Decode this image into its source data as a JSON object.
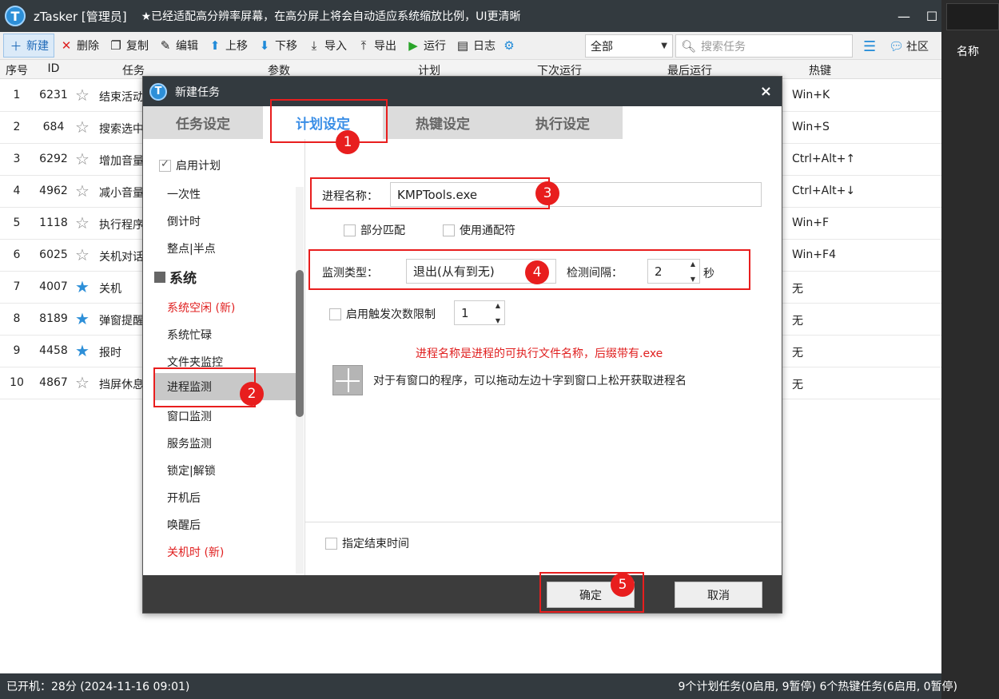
{
  "titlebar": {
    "title": "zTasker [管理员]",
    "notice": "★已经适配高分辨率屏幕，在高分屏上将会自动适应系统缩放比例，UI更清晰",
    "minimize": "—",
    "maximize": "☐"
  },
  "toolbar": {
    "new": "新建",
    "delete": "删除",
    "copy": "复制",
    "edit": "编辑",
    "move_up": "上移",
    "move_down": "下移",
    "import": "导入",
    "export": "导出",
    "run": "运行",
    "log": "日志",
    "filter_value": "全部",
    "search_placeholder": "搜索任务",
    "community": "社区"
  },
  "right_panel": {
    "label": "名称"
  },
  "table": {
    "headers": [
      "序号",
      "ID",
      "任务",
      "参数",
      "计划",
      "下次运行",
      "最后运行",
      "热键"
    ],
    "rows": [
      {
        "no": "1",
        "id": "6231",
        "task": "结束活动",
        "starred": false,
        "hotkey": "Win+K"
      },
      {
        "no": "2",
        "id": "684",
        "task": "搜索选中",
        "starred": false,
        "hotkey": "Win+S"
      },
      {
        "no": "3",
        "id": "6292",
        "task": "增加音量",
        "starred": false,
        "hotkey": "Ctrl+Alt+↑"
      },
      {
        "no": "4",
        "id": "4962",
        "task": "减小音量",
        "starred": false,
        "hotkey": "Ctrl+Alt+↓"
      },
      {
        "no": "5",
        "id": "1118",
        "task": "执行程序",
        "starred": false,
        "hotkey": "Win+F"
      },
      {
        "no": "6",
        "id": "6025",
        "task": "关机对话",
        "starred": false,
        "hotkey": "Win+F4"
      },
      {
        "no": "7",
        "id": "4007",
        "task": "关机",
        "starred": true,
        "hotkey": "无"
      },
      {
        "no": "8",
        "id": "8189",
        "task": "弹窗提醒",
        "starred": true,
        "hotkey": "无"
      },
      {
        "no": "9",
        "id": "4458",
        "task": "报时",
        "starred": true,
        "hotkey": "无"
      },
      {
        "no": "10",
        "id": "4867",
        "task": "挡屏休息",
        "starred": false,
        "hotkey": "无"
      }
    ]
  },
  "statusbar": {
    "uptime": "已开机：28分 (2024-11-16 09:01)",
    "summary": "9个计划任务(0启用, 9暂停)  6个热键任务(6启用, 0暂停)"
  },
  "dialog": {
    "title": "新建任务",
    "close": "×",
    "tabs": [
      "任务设定",
      "计划设定",
      "热键设定",
      "执行设定"
    ],
    "sidebar": {
      "enable_plan": "启用计划",
      "once": "一次性",
      "countdown": "倒计时",
      "hourly": "整点|半点",
      "section_system": "系统",
      "sys_idle": "系统空闲 (新)",
      "sys_busy": "系统忙碌",
      "folder_monitor": "文件夹监控",
      "process_monitor": "进程监测",
      "window_monitor": "窗口监测",
      "service_monitor": "服务监测",
      "lock_unlock": "锁定|解锁",
      "after_boot": "开机后",
      "after_wake": "唤醒后",
      "shutdown_time": "关机时 (新)"
    },
    "process_name_label": "进程名称：",
    "process_name_value": "KMPTools.exe",
    "partial_match": "部分匹配",
    "use_wildcard": "使用通配符",
    "monitor_type_label": "监测类型：",
    "monitor_type_value": "退出(从有到无)",
    "interval_label": "检测间隔：",
    "interval_value": "2",
    "interval_unit": "秒",
    "trigger_limit_label": "启用触发次数限制",
    "trigger_limit_value": "1",
    "hint": "进程名称是进程的可执行文件名称，后缀带有.exe",
    "drag_hint": "对于有窗口的程序，可以拖动左边十字到窗口上松开获取进程名",
    "end_time_label": "指定结束时间",
    "ok": "确定",
    "cancel": "取消"
  },
  "annotations": [
    "1",
    "2",
    "3",
    "4",
    "5"
  ]
}
